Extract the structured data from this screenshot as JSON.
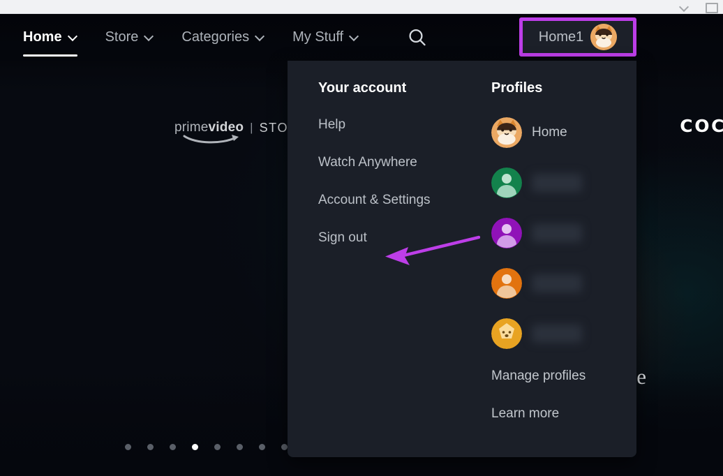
{
  "browser": {
    "icons": [
      "chevron-down-icon",
      "window-icon"
    ]
  },
  "hero": {
    "brand_light": "prime",
    "brand_bold": "video",
    "brand_divider": "|",
    "brand_store": "STORE",
    "title_art": "COCA",
    "sub_art": "e"
  },
  "nav": {
    "items": [
      {
        "label": "Home",
        "caret": true,
        "active": true
      },
      {
        "label": "Store",
        "caret": true,
        "active": false
      },
      {
        "label": "Categories",
        "caret": true,
        "active": false
      },
      {
        "label": "My Stuff",
        "caret": true,
        "active": false
      }
    ],
    "search_icon": "search-icon",
    "profile_button": {
      "label": "Home1",
      "avatar": "cat-avatar",
      "highlight_color": "#bd3ee8"
    }
  },
  "dropdown": {
    "account": {
      "heading": "Your account",
      "links": [
        {
          "label": "Help"
        },
        {
          "label": "Watch Anywhere"
        },
        {
          "label": "Account & Settings"
        },
        {
          "label": "Sign out"
        }
      ]
    },
    "profiles": {
      "heading": "Profiles",
      "list": [
        {
          "name": "Home",
          "redacted": false,
          "avatar": "cat-avatar",
          "color": "#e7a55f"
        },
        {
          "name": "",
          "redacted": true,
          "avatar": "person-avatar",
          "color": "#13824c"
        },
        {
          "name": "",
          "redacted": true,
          "avatar": "person-avatar",
          "color": "#9012b8"
        },
        {
          "name": "",
          "redacted": true,
          "avatar": "person-avatar",
          "color": "#e2730f"
        },
        {
          "name": "",
          "redacted": true,
          "avatar": "kid-avatar",
          "color": "#e8a322"
        }
      ],
      "actions": [
        {
          "label": "Manage profiles"
        },
        {
          "label": "Learn more"
        }
      ]
    }
  },
  "annotation": {
    "arrow_color": "#bd3ee8",
    "points_to": "Sign out"
  },
  "carousel": {
    "total": 8,
    "active_index": 3
  },
  "colors": {
    "accent_highlight": "#bd3ee8",
    "panel_bg": "#1b1f28",
    "page_bg": "#05070d",
    "text_primary": "#ffffff",
    "text_secondary": "#bcc1c8"
  }
}
